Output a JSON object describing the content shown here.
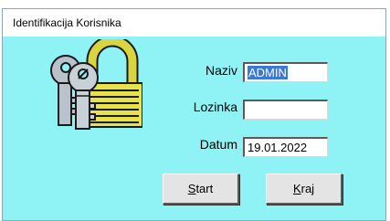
{
  "window": {
    "title": "Identifikacija Korisnika"
  },
  "form": {
    "naziv_label": "Naziv",
    "naziv_value": "ADMIN",
    "lozinka_label": "Lozinka",
    "lozinka_value": "",
    "datum_label": "Datum",
    "datum_value": "19.01.2022"
  },
  "buttons": {
    "start": {
      "mnemonic": "S",
      "rest": "tart"
    },
    "kraj": {
      "mnemonic": "K",
      "rest": "raj"
    }
  },
  "icons": {
    "logo": "keys-padlock-icon"
  },
  "colors": {
    "client_bg": "#8ff3f6",
    "selection": "#3b78d8",
    "padlock": "#e8e24a"
  }
}
